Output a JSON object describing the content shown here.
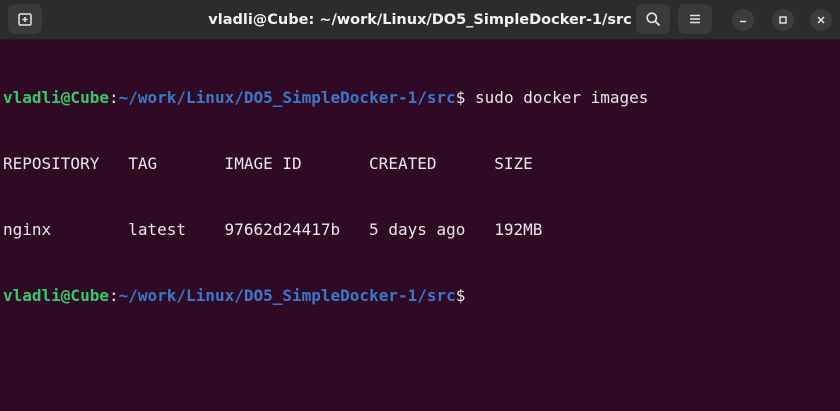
{
  "window": {
    "title": "vladli@Cube: ~/work/Linux/DO5_SimpleDocker-1/src",
    "buttons": {
      "new_tab_icon": "new-tab-icon",
      "search_icon": "search-icon",
      "menu_icon": "hamburger-menu-icon",
      "minimize_icon": "minimize-icon",
      "maximize_icon": "maximize-icon",
      "close_icon": "close-icon"
    }
  },
  "terminal": {
    "prompt1": {
      "user": "vladli@Cube",
      "colon": ":",
      "path": "~/work/Linux/DO5_SimpleDocker-1/src",
      "dollar": "$",
      "command": " sudo docker images"
    },
    "output": {
      "header": "REPOSITORY   TAG       IMAGE ID       CREATED      SIZE",
      "rows": [
        "nginx        latest    97662d24417b   5 days ago   192MB"
      ]
    },
    "prompt2": {
      "user": "vladli@Cube",
      "colon": ":",
      "path": "~/work/Linux/DO5_SimpleDocker-1/src",
      "dollar": "$",
      "command": ""
    }
  },
  "colors": {
    "background": "#300a24",
    "titlebar": "#2c2c2c",
    "prompt_user": "#34c96a",
    "prompt_path": "#3a78c9",
    "text": "#e8e8e8"
  }
}
